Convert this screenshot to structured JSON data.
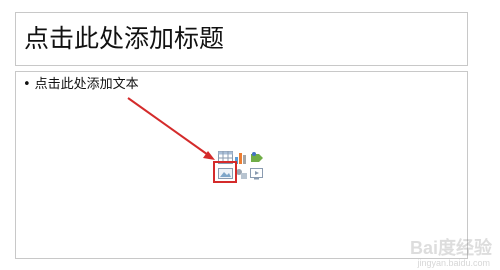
{
  "slide": {
    "title_placeholder": "点击此处添加标题",
    "content_placeholder": "点击此处添加文本",
    "bullet": "•"
  },
  "content_icons": [
    "table-icon",
    "chart-icon",
    "smartart-icon",
    "picture-icon",
    "clipart-icon",
    "media-icon"
  ],
  "highlight_color": "#d42b2b",
  "watermark": {
    "brand": "Bai度经验",
    "url": "jingyan.baidu.com"
  }
}
